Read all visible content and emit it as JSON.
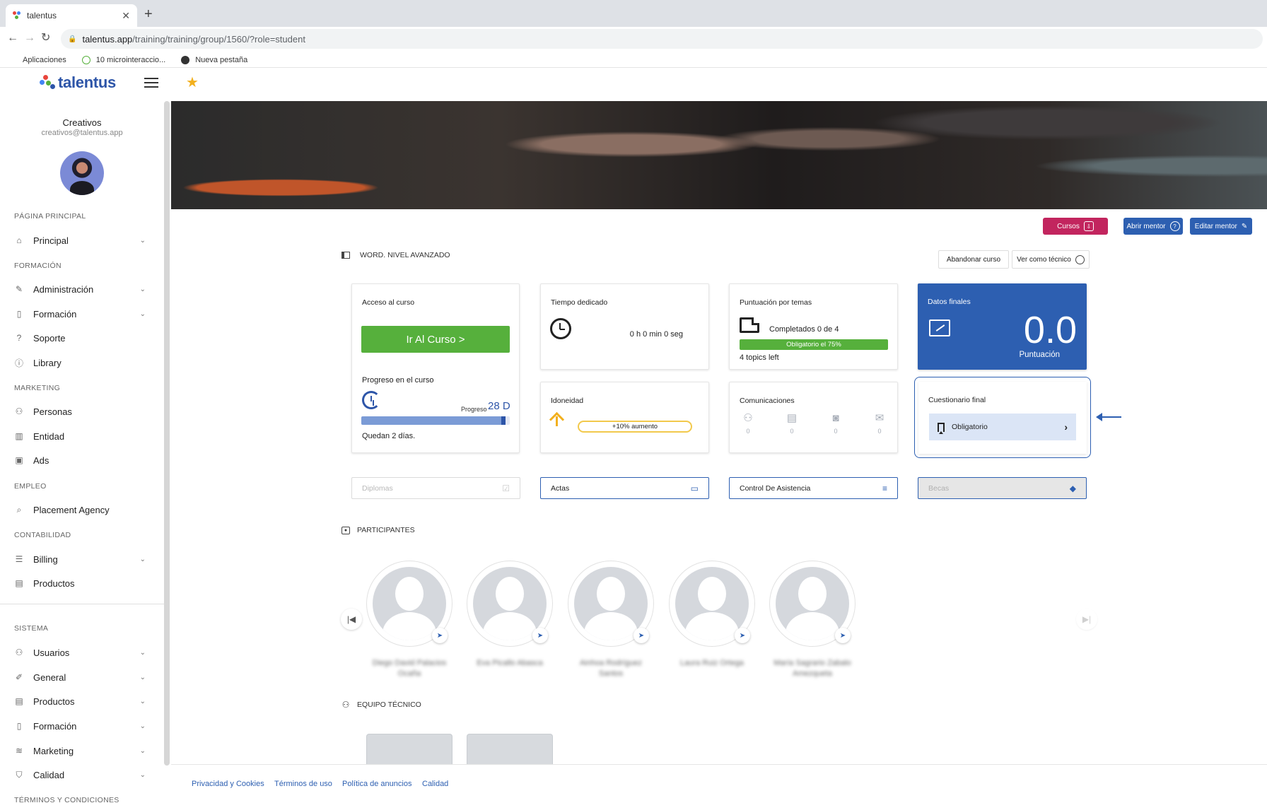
{
  "browser": {
    "tab_title": "talentus",
    "tab_close": "✕",
    "new_tab": "+",
    "url_host": "talentus.app",
    "url_path": "/training/training/group/1560/?role=student",
    "bookmarks": [
      "Aplicaciones",
      "10 microinteraccio...",
      "Nueva pestaña"
    ]
  },
  "brand": {
    "name": "talentus",
    "colors": {
      "primary": "#2d5fb1",
      "accent_pink": "#c2255e",
      "green": "#56b03c",
      "yellow": "#f2b01e"
    }
  },
  "user": {
    "name": "Creativos",
    "email": "creativos@talentus.app"
  },
  "sidebar": {
    "sections": {
      "main": "PÁGINA PRINCIPAL",
      "training": "FORMACIÓN",
      "marketing": "MARKETING",
      "employment": "EMPLEO",
      "accounting": "CONTABILIDAD",
      "system": "SISTEMA",
      "terms": "TÉRMINOS Y CONDICIONES"
    },
    "items": {
      "principal": "Principal",
      "administracion": "Administración",
      "formacion": "Formación",
      "soporte": "Soporte",
      "library": "Library",
      "personas": "Personas",
      "entidad": "Entidad",
      "ads": "Ads",
      "placement": "Placement Agency",
      "billing": "Billing",
      "productos": "Productos",
      "usuarios": "Usuarios",
      "general": "General",
      "sys_productos": "Productos",
      "sys_formacion": "Formación",
      "sys_marketing": "Marketing",
      "calidad": "Calidad"
    }
  },
  "actions": {
    "cursos": "Cursos",
    "abrir_mentor": "Abrir mentor",
    "editar_mentor": "Editar mentor"
  },
  "course": {
    "title": "WORD. NIVEL AVANZADO",
    "abandon": "Abandonar curso",
    "view_tech": "Ver como técnico"
  },
  "cards": {
    "access": {
      "title": "Acceso al curso",
      "button": "Ir Al Curso >",
      "progress_title": "Progreso en el curso",
      "progress_label": "Progreso",
      "progress_days": "28 D",
      "progress_fraction": 0.97,
      "remaining": "Quedan 2 días."
    },
    "time": {
      "title": "Tiempo dedicado",
      "value": "0 h 0 min 0 seg"
    },
    "topics": {
      "title": "Puntuación por temas",
      "completed": "Completados 0 de 4",
      "required": "Obligatorio el 75%",
      "left": "4 topics left"
    },
    "final": {
      "title": "Datos finales",
      "score": "0.0",
      "caption": "Puntuación"
    },
    "suitability": {
      "title": "Idoneidad",
      "increase": "+10% aumento"
    },
    "communications": {
      "title": "Comunicaciones",
      "counts": [
        "0",
        "0",
        "0",
        "0"
      ]
    },
    "quiz": {
      "title": "Cuestionario final",
      "item": "Obligatorio"
    }
  },
  "documents": {
    "diplomas": "Diplomas",
    "actas": "Actas",
    "attendance": "Control De Asistencia",
    "becas": "Becas"
  },
  "participants": {
    "title": "PARTICIPANTES",
    "names": [
      "Diego David Palacios Ocaña",
      "Eva Picallo Abasca",
      "Ainhoa Rodríguez Santos",
      "Laura Ruiz Ortega",
      "María Sagrario Zabalo Amezqueta"
    ]
  },
  "tech_team": {
    "title": "EQUIPO TÉCNICO"
  },
  "footer": {
    "privacy": "Privacidad y Cookies",
    "terms": "Términos de uso",
    "ads_policy": "Política de anuncios",
    "quality": "Calidad"
  }
}
